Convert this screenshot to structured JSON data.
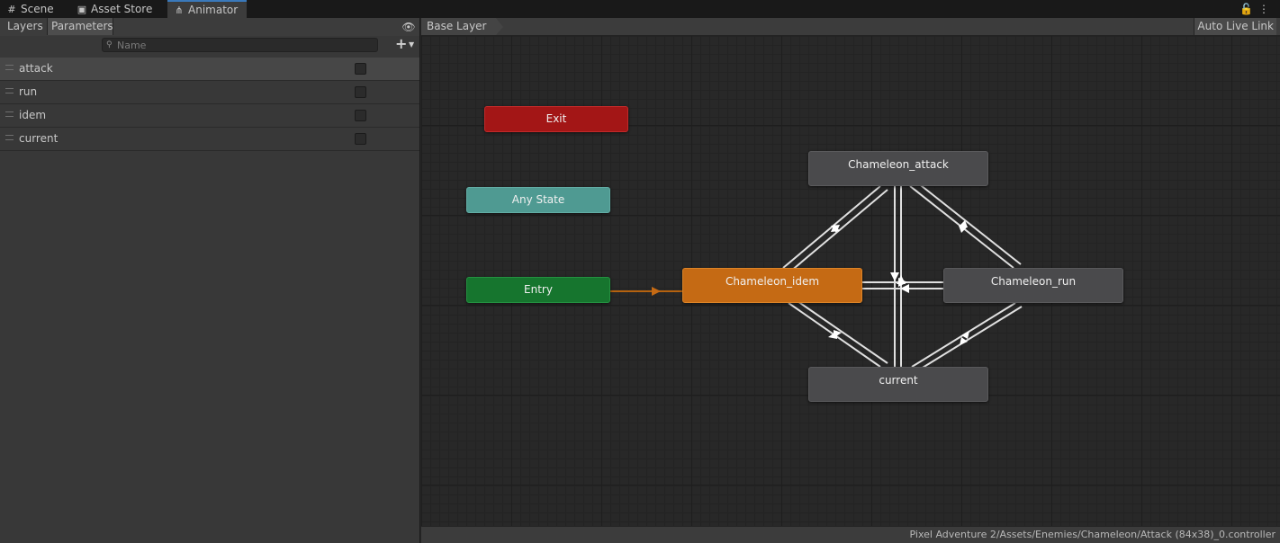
{
  "tabs": [
    {
      "label": "Scene",
      "icon": "grid-icon"
    },
    {
      "label": "Asset Store",
      "icon": "shopping-bag-icon"
    },
    {
      "label": "Animator",
      "icon": "animator-icon",
      "active": true
    }
  ],
  "left_panel": {
    "tabs": [
      "Layers",
      "Parameters"
    ],
    "active_tab": "Parameters",
    "search": {
      "placeholder": "Name",
      "value": ""
    },
    "parameters": [
      {
        "name": "attack",
        "type": "bool",
        "checked": false,
        "selected": true
      },
      {
        "name": "run",
        "type": "bool",
        "checked": false
      },
      {
        "name": "idem",
        "type": "bool",
        "checked": false
      },
      {
        "name": "current",
        "type": "bool",
        "checked": false
      }
    ]
  },
  "graph": {
    "layer_name": "Base Layer",
    "auto_live_link_label": "Auto Live Link",
    "nodes": {
      "exit": "Exit",
      "any_state": "Any State",
      "entry": "Entry",
      "idem": "Chameleon_idem",
      "attack": "Chameleon_attack",
      "run": "Chameleon_run",
      "current": "current"
    },
    "colors": {
      "exit": "#a31616",
      "any_state": "#4f9a92",
      "entry": "#16752e",
      "default_state": "#c56a14",
      "state": "#4a4a4c",
      "transition": "#e6e6e6",
      "entry_transition": "#c56a14"
    }
  },
  "status": {
    "path": "Pixel Adventure 2/Assets/Enemies/Chameleon/Attack (84x38)_0.controller"
  }
}
